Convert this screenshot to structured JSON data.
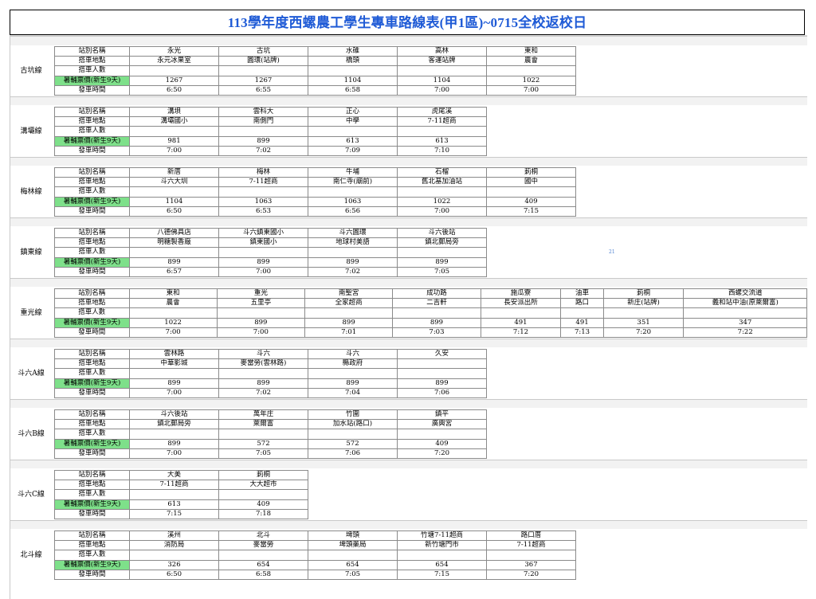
{
  "title": "113學年度西螺農工學生專車路線表(甲1區)~0715全校返校日",
  "row_labels": {
    "station": "站別名稱",
    "stop": "搭車地點",
    "riders": "搭車人數",
    "fare": "暑輔票價(新生9天)",
    "time": "發車時間"
  },
  "stray_text": "21",
  "routes": [
    {
      "name": "古坑線",
      "stations": [
        "永光",
        "古坑",
        "水碓",
        "高林",
        "東和"
      ],
      "stops": [
        "永元冰果室",
        "圓環(站牌)",
        "橋頭",
        "客運站牌",
        "農會"
      ],
      "fares": [
        "1267",
        "1267",
        "1104",
        "1104",
        "1022"
      ],
      "times": [
        "6:50",
        "6:55",
        "6:58",
        "7:00",
        "7:00"
      ]
    },
    {
      "name": "溝壩線",
      "stations": [
        "溝垻",
        "雲科大",
        "正心",
        "虎尾溪"
      ],
      "stops": [
        "溝壩國小",
        "南側門",
        "中學",
        "7-11超商"
      ],
      "fares": [
        "981",
        "899",
        "613",
        "613"
      ],
      "times": [
        "7:00",
        "7:02",
        "7:09",
        "7:10"
      ]
    },
    {
      "name": "梅林線",
      "stations": [
        "新厝",
        "梅林",
        "牛埔",
        "石榴",
        "莿桐"
      ],
      "stops": [
        "斗六大圳",
        "7-11超商",
        "南仁寺(廟前)",
        "舊北基加油站",
        "國中"
      ],
      "fares": [
        "1104",
        "1063",
        "1063",
        "1022",
        "409"
      ],
      "times": [
        "6:50",
        "6:53",
        "6:56",
        "7:00",
        "7:15"
      ]
    },
    {
      "name": "鎮東線",
      "stations": [
        "八德佛具店",
        "斗六鎮東國小",
        "斗六圓環",
        "斗六後站"
      ],
      "stops": [
        "明糖製香廠",
        "鎮東國小",
        "地球村美語",
        "鎮北郵局旁"
      ],
      "fares": [
        "899",
        "899",
        "899",
        "899"
      ],
      "times": [
        "6:57",
        "7:00",
        "7:02",
        "7:05"
      ]
    },
    {
      "name": "重光線",
      "stations": [
        "東和",
        "重光",
        "南聖宮",
        "成功路",
        "施瓜寮",
        "油車",
        "莿桐",
        "西螺交流道"
      ],
      "stops": [
        "農會",
        "五里亭",
        "全家超商",
        "二吉軒",
        "長安派出所",
        "路口",
        "新庄(站牌)",
        "義和站中油(原萊爾富)"
      ],
      "fares": [
        "1022",
        "899",
        "899",
        "899",
        "491",
        "491",
        "351",
        "347"
      ],
      "times": [
        "7:00",
        "7:00",
        "7:01",
        "7:03",
        "7:12",
        "7:13",
        "7:20",
        "7:22"
      ]
    },
    {
      "name": "斗六A線",
      "stations": [
        "雲林路",
        "斗六",
        "斗六",
        "久安"
      ],
      "stops": [
        "中華影城",
        "麥當勞(雲林路)",
        "縣政府",
        ""
      ],
      "fares": [
        "899",
        "899",
        "899",
        "899"
      ],
      "times": [
        "7:00",
        "7:02",
        "7:04",
        "7:06"
      ]
    },
    {
      "name": "斗六B線",
      "stations": [
        "斗六後站",
        "萬年庄",
        "竹圍",
        "鎮平"
      ],
      "stops": [
        "鎮北郵局旁",
        "萊爾富",
        "加水站(路口)",
        "廣興宮"
      ],
      "fares": [
        "899",
        "572",
        "572",
        "409"
      ],
      "times": [
        "7:00",
        "7:05",
        "7:06",
        "7:20"
      ]
    },
    {
      "name": "斗六C線",
      "stations": [
        "大美",
        "莿桐"
      ],
      "stops": [
        "7-11超商",
        "大大超市"
      ],
      "fares": [
        "613",
        "409"
      ],
      "times": [
        "7:15",
        "7:18"
      ]
    },
    {
      "name": "北斗線",
      "stations": [
        "溪州",
        "北斗",
        "埤頭",
        "竹塘7-11超商",
        "路口厝"
      ],
      "stops": [
        "消防局",
        "麥當勞",
        "埤頭藥局",
        "新竹塘門市",
        "7-11超商"
      ],
      "fares": [
        "326",
        "654",
        "654",
        "654",
        "367"
      ],
      "times": [
        "6:50",
        "6:58",
        "7:05",
        "7:15",
        "7:20"
      ]
    }
  ]
}
